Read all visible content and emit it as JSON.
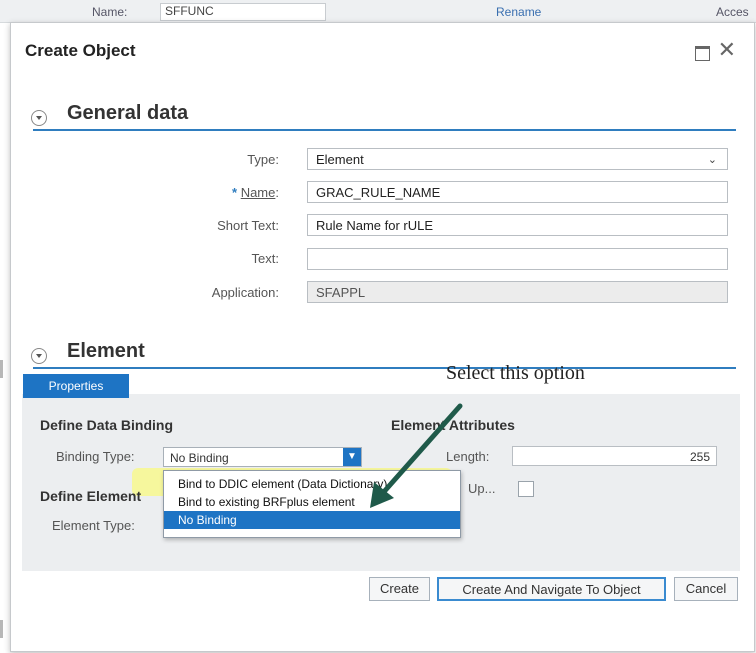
{
  "background_bar": {
    "name_label": "Name:",
    "name_value": "SFFUNC",
    "rename_link": "Rename",
    "access_text": "Acces"
  },
  "dialog": {
    "title": "Create Object",
    "general_section": {
      "title": "General data",
      "fields": [
        {
          "label": "Type:",
          "value": "Element"
        },
        {
          "label": "Name",
          "required_marker": "*",
          "value": "GRAC_RULE_NAME"
        },
        {
          "label": "Short Text:",
          "value": "Rule Name for rULE"
        },
        {
          "label": "Text:",
          "value": ""
        },
        {
          "label": "Application:",
          "value": "SFAPPL"
        }
      ]
    },
    "element_section": {
      "title": "Element",
      "tab_label": "Properties",
      "data_binding": {
        "group_title": "Define Data Binding",
        "binding_type_label": "Binding Type:",
        "binding_type_value": "No Binding",
        "options": [
          "Bind to DDIC element (Data Dictionary)",
          "Bind to existing BRFplus element",
          "No Binding"
        ],
        "selected_option": "No Binding"
      },
      "define_element": {
        "group_title": "Define Element",
        "element_type_label": "Element Type:"
      },
      "attributes": {
        "group_title": "Element Attributes",
        "length_label": "Length:",
        "length_value": "255",
        "lookup_label": "Up..."
      }
    },
    "annotation": "Select this option",
    "buttons": {
      "create": "Create",
      "create_navigate": "Create And Navigate To Object",
      "cancel": "Cancel"
    }
  },
  "colors": {
    "accent": "#1e74c4",
    "section_line": "#2f7dbf",
    "highlight": "#ffff5a"
  }
}
